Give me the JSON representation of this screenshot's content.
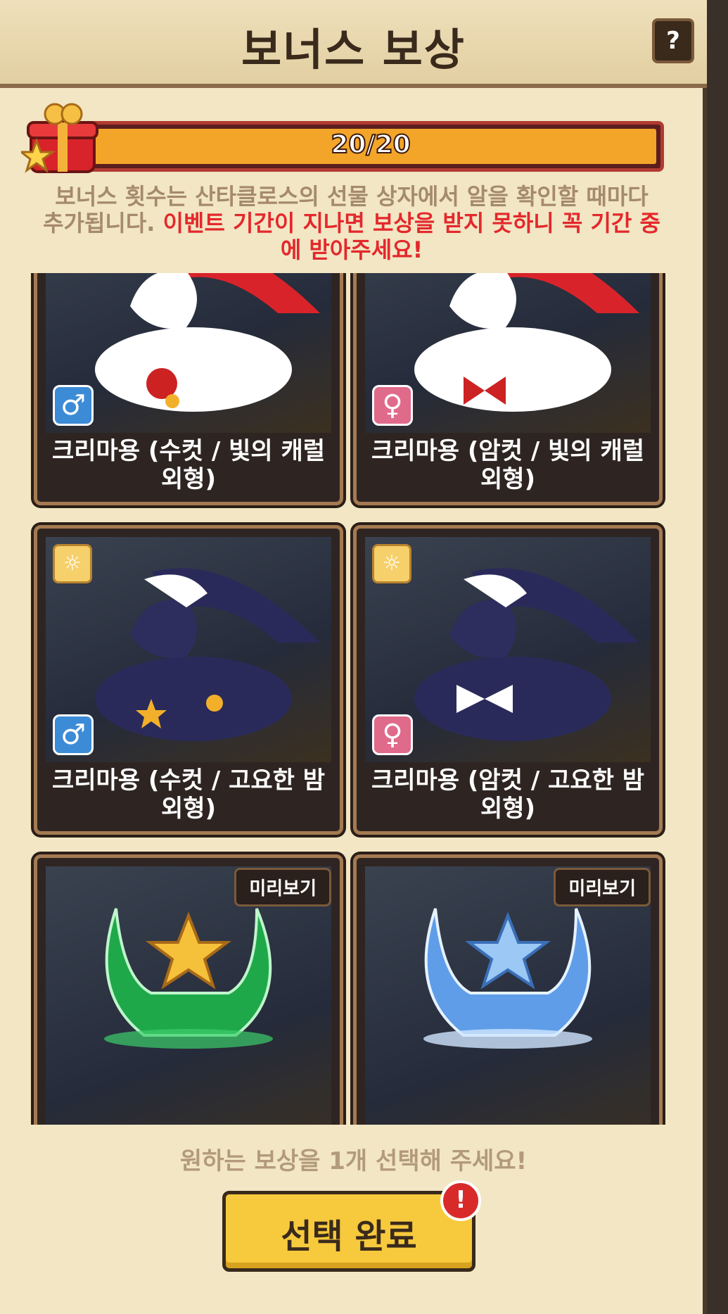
{
  "header": {
    "title": "보너스 보상",
    "help_label": "?"
  },
  "progress": {
    "text": "20/20",
    "current": 20,
    "max": 20,
    "fill_color": "#f3a52a"
  },
  "description": {
    "normal": "보너스 횟수는 산타클로스의 선물 상자에서 알을 확인할 때마다 추가됩니다.",
    "highlight": "이벤트 기간이 지나면 보상을 받지 못하니 꼭 기간 중에 받아주세요!"
  },
  "rewards": [
    {
      "label": "크리마용 (수컷 / 빛의 캐럴 외형)",
      "gender_icon": "♂",
      "gender": "male",
      "theme": "red"
    },
    {
      "label": "크리마용 (암컷 / 빛의 캐럴 외형)",
      "gender_icon": "♀",
      "gender": "female",
      "theme": "red"
    },
    {
      "label": "크리마용 (수컷 / 고요한 밤 외형)",
      "gender_icon": "♂",
      "gender": "male",
      "theme": "navy"
    },
    {
      "label": "크리마용 (암컷 / 고요한 밤 외형)",
      "gender_icon": "♀",
      "gender": "female",
      "theme": "navy"
    },
    {
      "preview_label": "미리보기",
      "theme": "green-crest"
    },
    {
      "preview_label": "미리보기",
      "theme": "blue-crest"
    }
  ],
  "footer": {
    "instruction": "원하는 보상을 1개 선택해 주세요!",
    "confirm_label": "선택 완료",
    "alert_label": "!"
  },
  "colors": {
    "red_text": "#e3282c",
    "button_yellow": "#f7c93c",
    "male_badge": "#3c8bd6",
    "female_badge": "#e06a8a"
  }
}
